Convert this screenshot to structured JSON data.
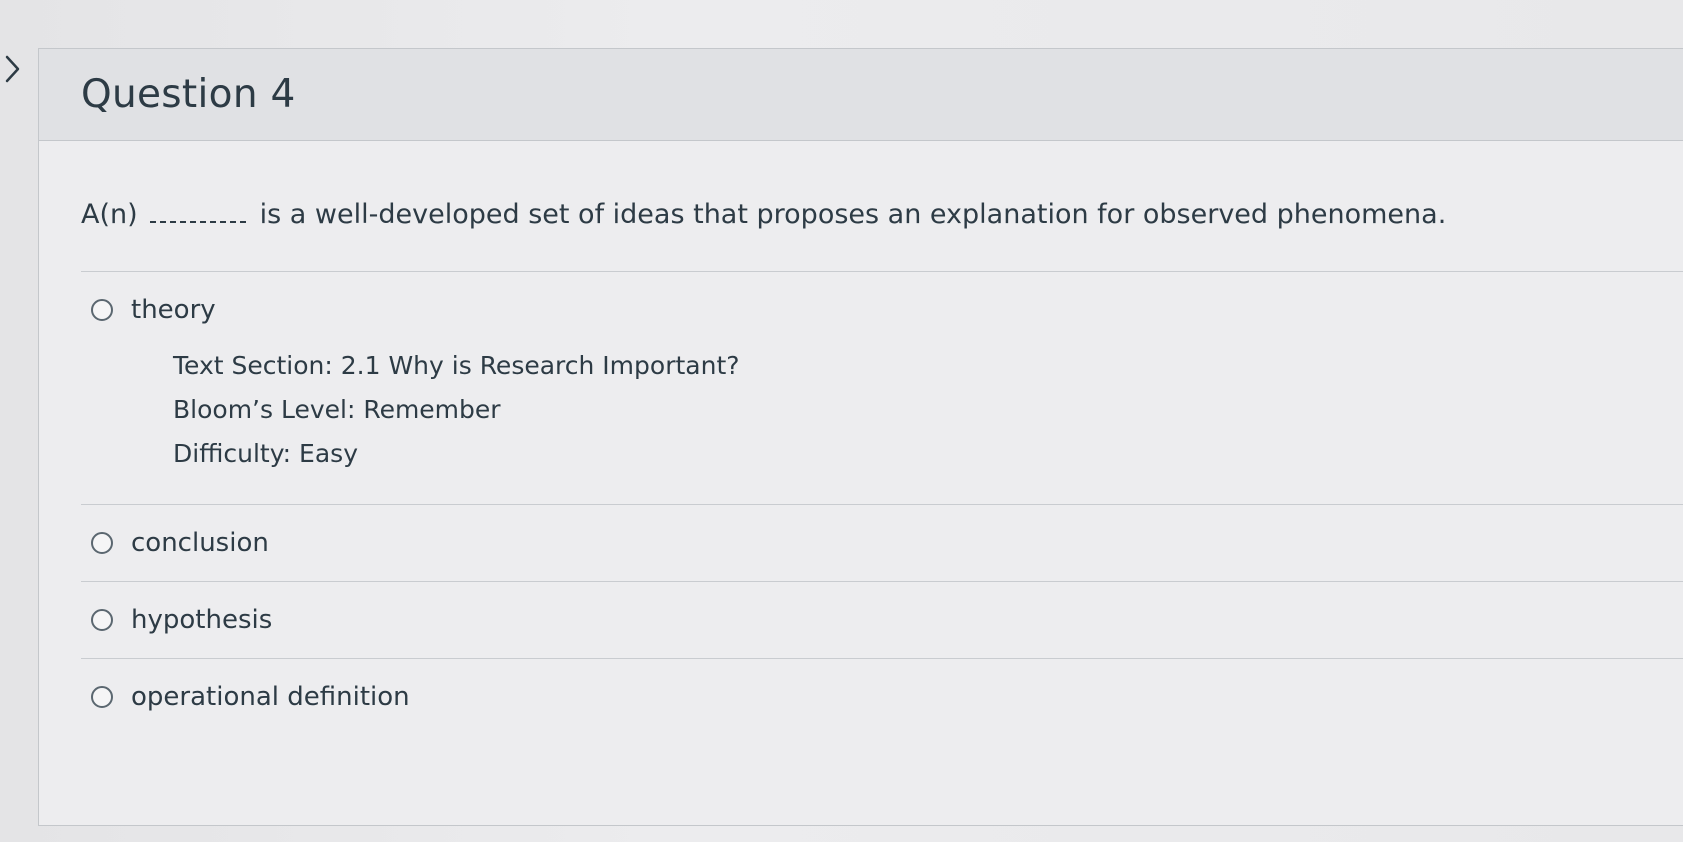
{
  "question": {
    "title": "Question 4",
    "prompt_before": "A(n)",
    "prompt_after": "is a well-developed set of ideas that proposes an explanation for observed phenomena.",
    "answers": [
      {
        "label": "theory"
      },
      {
        "label": "conclusion"
      },
      {
        "label": "hypothesis"
      },
      {
        "label": "operational definition"
      }
    ],
    "comment": {
      "text_section": "Text Section: 2.1 Why is Research Important?",
      "blooms_level": "Bloom’s Level: Remember",
      "difficulty": "Difficulty: Easy"
    }
  },
  "icons": {
    "expand": "chevron-right-icon",
    "answer_radio": "radio-unselected-icon"
  },
  "colors": {
    "text": "#2d3b45",
    "header_bg": "#e0e1e4",
    "border": "#c4c7cb"
  }
}
